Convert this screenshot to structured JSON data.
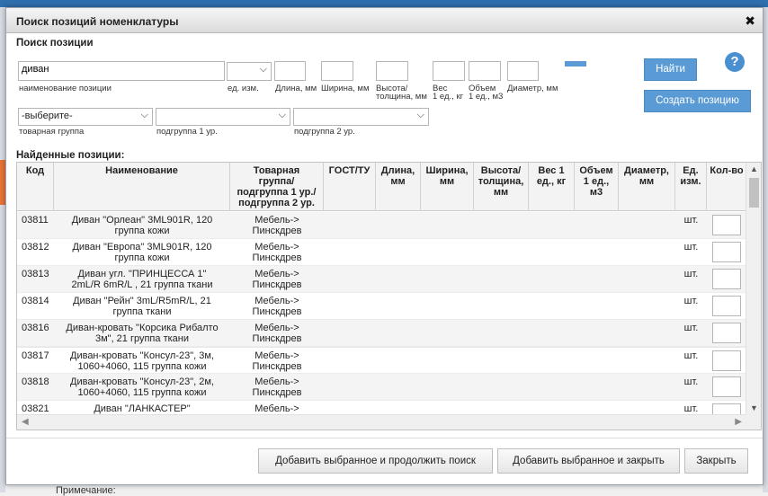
{
  "background": {
    "footer_text": "Примечание:"
  },
  "dialog": {
    "title": "Поиск позиций номенклатуры",
    "close_glyph": "✖",
    "search_section_title": "Поиск позиции",
    "fields": {
      "name_value": "диван",
      "name_label": "наименование позиции",
      "unit_label": "ед. изм.",
      "length_label": "Длина, мм",
      "width_label": "Ширина, мм",
      "height_label_1": "Высота/",
      "height_label_2": "толщина, мм",
      "weight_label_1": "Вес",
      "weight_label_2": "1 ед., кг",
      "volume_label_1": "Объем",
      "volume_label_2": "1 ед., м3",
      "diameter_label": "Диаметр, мм",
      "group_value": "-выберите-",
      "group_label": "товарная группа",
      "subgroup1_label": "подгруппа 1 ур.",
      "subgroup2_label": "подгруппа 2 ур."
    },
    "buttons": {
      "find": "Найти",
      "create": "Создать позицию",
      "help": "?",
      "add_continue": "Добавить выбранное и продолжить поиск",
      "add_close": "Добавить выбранное и закрыть",
      "close": "Закрыть"
    },
    "results_title": "Найденные позиции:",
    "columns": {
      "code": "Код",
      "name": "Наименование",
      "group_1": "Товарная",
      "group_2": "группа/",
      "group_3": "подгруппа 1 ур./",
      "group_4": "подгруппа 2 ур.",
      "gost": "ГОСТ/ТУ",
      "length_1": "Длина,",
      "length_2": "мм",
      "width_1": "Ширина,",
      "width_2": "мм",
      "height_1": "Высота/",
      "height_2": "толщина,",
      "height_3": "мм",
      "weight_1": "Вес 1",
      "weight_2": "ед., кг",
      "volume_1": "Объем",
      "volume_2": "1 ед.,",
      "volume_3": "м3",
      "diameter_1": "Диаметр,",
      "diameter_2": "мм",
      "unit_1": "Ед.",
      "unit_2": "изм.",
      "qty": "Кол-во"
    },
    "rows": [
      {
        "code": "03811",
        "name1": "Диван \"Орлеан\" 3ML901R, 120",
        "name2": "группа кожи",
        "g1": "Мебель->",
        "g2": "Пинскдрев",
        "unit": "шт."
      },
      {
        "code": "03812",
        "name1": "Диван \"Европа\" 3ML901R, 120",
        "name2": "группа кожи",
        "g1": "Мебель->",
        "g2": "Пинскдрев",
        "unit": "шт."
      },
      {
        "code": "03813",
        "name1": "Диван угл. \"ПРИНЦЕССА 1\"",
        "name2": "2mL/R 6mR/L , 21 группа ткани",
        "g1": "Мебель->",
        "g2": "Пинскдрев",
        "unit": "шт."
      },
      {
        "code": "03814",
        "name1": "Диван \"Рейн\" 3mL/R5mR/L, 21",
        "name2": "группа ткани",
        "g1": "Мебель->",
        "g2": "Пинскдрев",
        "unit": "шт."
      },
      {
        "code": "03816",
        "name1": "Диван-кровать \"Корсика Рибалто",
        "name2": "3м\", 21 группа ткани",
        "g1": "Мебель->",
        "g2": "Пинскдрев",
        "unit": "шт."
      },
      {
        "code": "03817",
        "name1": "Диван-кровать \"Консул-23\", 3м,",
        "name2": "1060+4060, 115 группа кожи",
        "g1": "Мебель->",
        "g2": "Пинскдрев",
        "unit": "шт."
      },
      {
        "code": "03818",
        "name1": "Диван-кровать \"Консул-23\", 2м,",
        "name2": "1060+4060, 115 группа кожи",
        "g1": "Мебель->",
        "g2": "Пинскдрев",
        "unit": "шт."
      },
      {
        "code": "03821",
        "name1": "Диван \"ЛАНКАСТЕР\"",
        "name2": "",
        "g1": "Мебель->",
        "g2": "",
        "unit": "шт."
      }
    ]
  },
  "colors": {
    "accent": "#5b9bd5",
    "header_blue": "#2f6fae"
  }
}
